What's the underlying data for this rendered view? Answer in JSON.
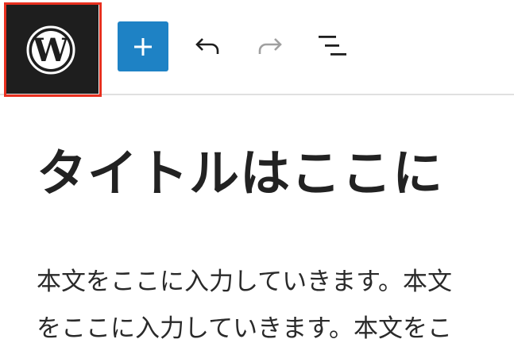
{
  "toolbar": {
    "logo_icon": "wordpress-logo-icon",
    "add_icon": "plus-icon",
    "undo_icon": "undo-icon",
    "redo_icon": "redo-icon",
    "list_view_icon": "list-view-icon",
    "colors": {
      "logo_bg": "#1e1e1e",
      "highlight": "#e8301f",
      "add_bg": "#1e82c5",
      "redo_disabled": "#a0a0a0"
    }
  },
  "editor": {
    "title": "タイトルはここに",
    "paragraph_lines": [
      "本文をここに入力していきます。本文",
      "をここに入力していきます。本文をこ"
    ]
  }
}
